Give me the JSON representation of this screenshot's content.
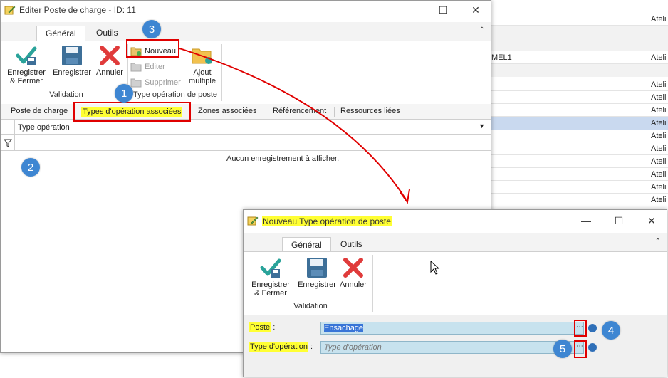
{
  "background_list": {
    "items": [
      {
        "right": "Ateli",
        "left": ""
      },
      {
        "right": "",
        "left": ""
      },
      {
        "right": "Ateli",
        "left": "MEL1"
      },
      {
        "right": "Ateli",
        "left": ""
      },
      {
        "right": "Ateli",
        "left": ""
      },
      {
        "right": "Ateli",
        "left": ""
      },
      {
        "right": "Ateli",
        "left": ""
      },
      {
        "right": "Ateli",
        "left": ""
      },
      {
        "right": "Ateli",
        "left": ""
      },
      {
        "right": "Ateli",
        "left": ""
      },
      {
        "right": "Ateli",
        "left": ""
      },
      {
        "right": "Ateli",
        "left": ""
      },
      {
        "right": "Ateli",
        "left": ""
      }
    ]
  },
  "main_window": {
    "title": "Editer Poste de charge - ID: 11",
    "ribbon_tabs": [
      "Général",
      "Outils"
    ],
    "buttons": {
      "save_close": "Enregistrer & Fermer",
      "save": "Enregistrer",
      "cancel": "Annuler",
      "new": "Nouveau",
      "edit": "Editer",
      "delete": "Supprimer",
      "multi_add": "Ajout multiple"
    },
    "groups": {
      "validation": "Validation",
      "op_type": "Type opération de poste"
    },
    "form_tabs": [
      "Poste de charge",
      "Types d'opération associées",
      "Zones associées",
      "Référencement",
      "Ressources liées"
    ],
    "grid": {
      "column": "Type opération",
      "empty_message": "Aucun enregistrement à afficher."
    }
  },
  "dialog": {
    "title": "Nouveau Type opération de poste",
    "ribbon_tabs": [
      "Général",
      "Outils"
    ],
    "buttons": {
      "save_close": "Enregistrer & Fermer",
      "save": "Enregistrer",
      "cancel": "Annuler"
    },
    "groups": {
      "validation": "Validation"
    },
    "fields": {
      "poste_label": "Poste",
      "poste_value": "Ensachage",
      "type_label": "Type d'opération",
      "type_placeholder": "Type d'opération"
    }
  },
  "badges": [
    "1",
    "2",
    "3",
    "4",
    "5"
  ],
  "colors": {
    "highlight": "#ffff33",
    "annotation_red": "#e00000",
    "badge_blue": "#3e86d2",
    "field_bg": "#c7e2ee",
    "selected_row": "#c9d9ef"
  }
}
